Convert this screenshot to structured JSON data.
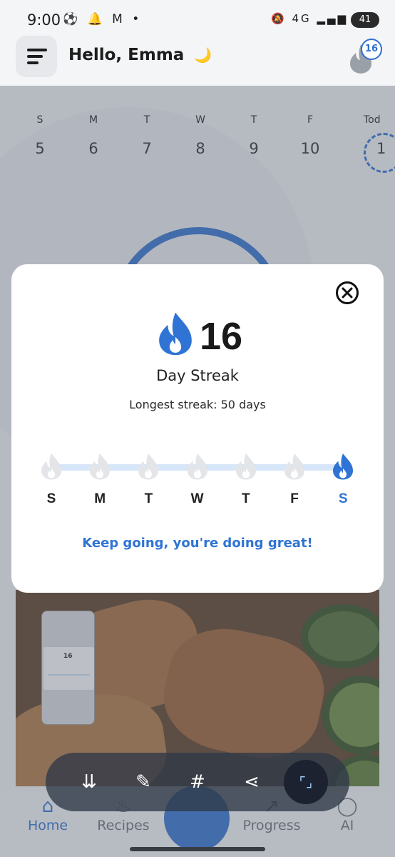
{
  "status_bar": {
    "time": "9:00",
    "left_icons": "⚽ 🔔 M •",
    "network": "4G",
    "battery": "41"
  },
  "header": {
    "greeting": "Hello, Emma",
    "moon_icon": "🌙",
    "streak_count": "16"
  },
  "week": [
    {
      "letter": "S",
      "date": "5"
    },
    {
      "letter": "M",
      "date": "6"
    },
    {
      "letter": "T",
      "date": "7"
    },
    {
      "letter": "W",
      "date": "8"
    },
    {
      "letter": "T",
      "date": "9"
    },
    {
      "letter": "F",
      "date": "10"
    },
    {
      "letter": "Tod",
      "date": "1"
    }
  ],
  "modal": {
    "count": "16",
    "label": "Day Streak",
    "longest": "Longest streak: 50 days",
    "days": [
      {
        "letter": "S",
        "done": false
      },
      {
        "letter": "M",
        "done": false
      },
      {
        "letter": "T",
        "done": false
      },
      {
        "letter": "W",
        "done": false
      },
      {
        "letter": "T",
        "done": false
      },
      {
        "letter": "F",
        "done": false
      },
      {
        "letter": "S",
        "done": true
      }
    ],
    "encouragement": "Keep going, you're doing great!",
    "accent": "#2f74d4",
    "inactive_flame": "#e3e5e8"
  },
  "thumbnail": {
    "count": "16"
  },
  "bottom_nav": {
    "items": [
      {
        "label": "Home",
        "icon": "⌂",
        "active": true
      },
      {
        "label": "Recipes",
        "icon": "♨",
        "active": false
      },
      {
        "label": "Progress",
        "icon": "↗",
        "active": false
      },
      {
        "label": "AI",
        "icon": "◯",
        "active": false
      }
    ]
  },
  "screenshot_toolbar": {
    "tools": [
      {
        "name": "scroll-capture-icon",
        "glyph": "⇊"
      },
      {
        "name": "crop-edit-icon",
        "glyph": "✎"
      },
      {
        "name": "tag-icon",
        "glyph": "#"
      },
      {
        "name": "share-icon",
        "glyph": "⋖"
      },
      {
        "name": "screen-select-icon",
        "glyph": "⌜⌟"
      }
    ]
  }
}
